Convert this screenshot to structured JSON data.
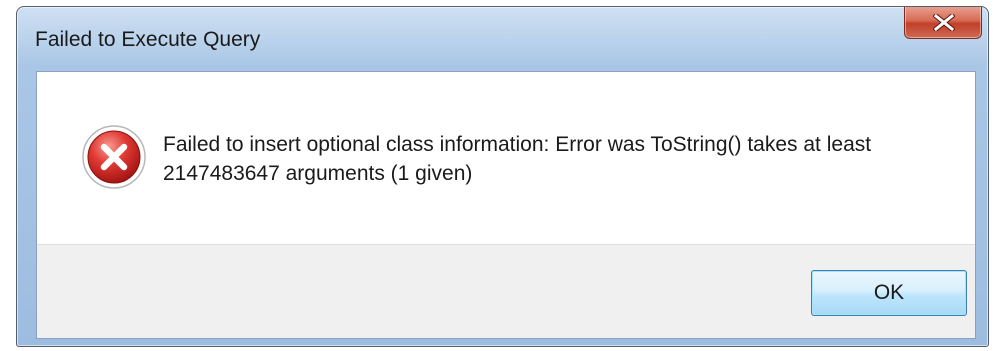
{
  "dialog": {
    "title": "Failed to Execute Query",
    "icon": "error-icon",
    "message": "Failed to insert optional class information: Error was ToString() takes at least 2147483647 arguments (1 given)",
    "ok_label": "OK",
    "close_icon": "close-icon"
  },
  "colors": {
    "close_button": "#c7432d",
    "error_icon": "#d42a2a",
    "button_area": "#f0f0f0",
    "frame": "#b9d1ea"
  }
}
